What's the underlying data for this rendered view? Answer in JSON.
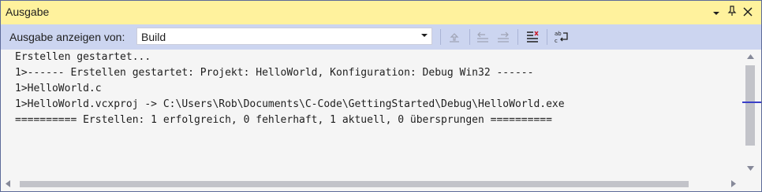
{
  "window": {
    "title": "Ausgabe"
  },
  "toolbar": {
    "label": "Ausgabe anzeigen von:",
    "source_value": "Build"
  },
  "output_lines": [
    "Erstellen gestartet...",
    "1>------ Erstellen gestartet: Projekt: HelloWorld, Konfiguration: Debug Win32 ------",
    "1>HelloWorld.c",
    "1>HelloWorld.vcxproj -> C:\\Users\\Rob\\Documents\\C-Code\\GettingStarted\\Debug\\HelloWorld.exe",
    "========== Erstellen: 1 erfolgreich, 0 fehlerhaft, 1 aktuell, 0 übersprungen =========="
  ],
  "colors": {
    "title_bar": "#fff29d",
    "toolbar": "#ccd5f0",
    "scroll_marker": "#3a3fc8"
  }
}
